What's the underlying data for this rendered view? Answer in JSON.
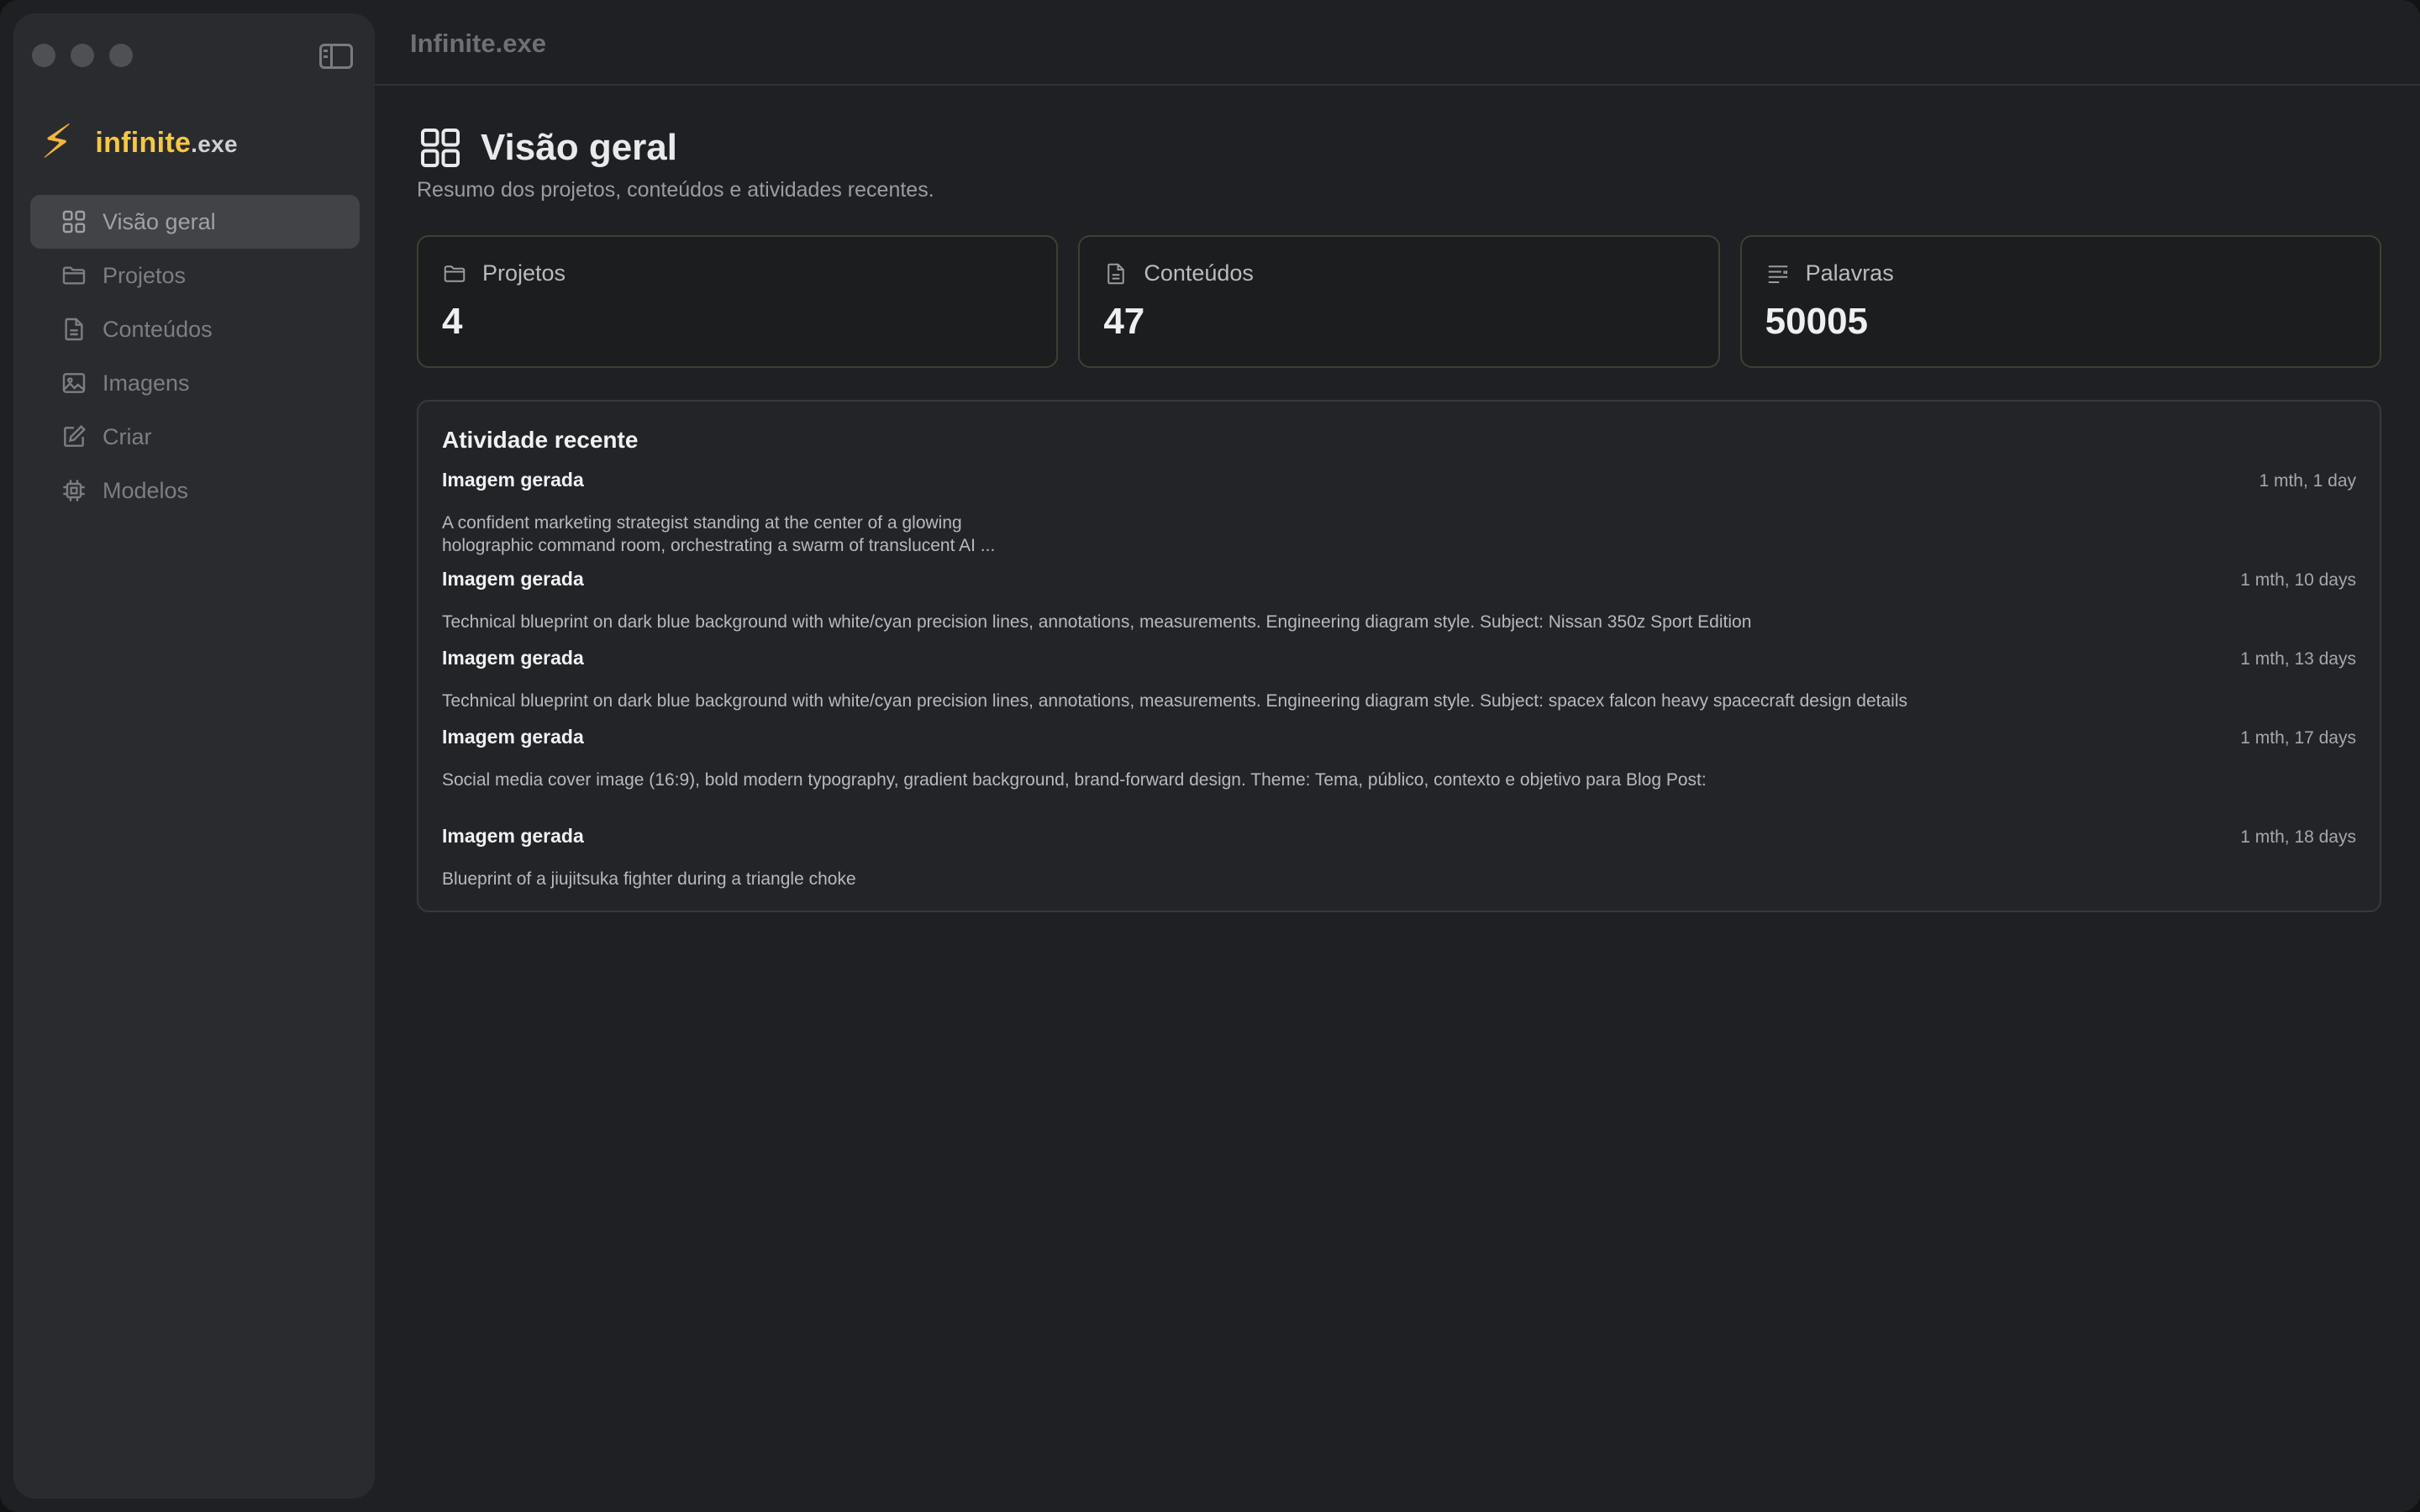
{
  "window": {
    "title": "Infinite.exe"
  },
  "brand": {
    "name": "infinite",
    "ext": ".exe"
  },
  "sidebar": {
    "items": [
      {
        "label": "Visão geral",
        "icon": "grid-icon",
        "active": true
      },
      {
        "label": "Projetos",
        "icon": "folder-icon"
      },
      {
        "label": "Conteúdos",
        "icon": "document-icon"
      },
      {
        "label": "Imagens",
        "icon": "image-icon"
      },
      {
        "label": "Criar",
        "icon": "edit-icon"
      },
      {
        "label": "Modelos",
        "icon": "chip-icon"
      }
    ]
  },
  "page": {
    "title": "Visão geral",
    "subtitle": "Resumo dos projetos, conteúdos e atividades recentes."
  },
  "stats": [
    {
      "label": "Projetos",
      "value": "4",
      "icon": "folder-icon"
    },
    {
      "label": "Conteúdos",
      "value": "47",
      "icon": "document-icon"
    },
    {
      "label": "Palavras",
      "value": "50005",
      "icon": "text-lines-icon"
    }
  ],
  "activity": {
    "title": "Atividade recente",
    "items": [
      {
        "type": "Imagem gerada",
        "time": "1 mth, 1 day",
        "description_lines": [
          "A confident marketing strategist standing at the center of a glowing",
          "holographic command room, orchestrating a swarm of translucent AI ..."
        ]
      },
      {
        "type": "Imagem gerada",
        "time": "1 mth, 10 days",
        "description_lines": [
          "Technical blueprint on dark blue background with white/cyan precision lines, annotations, measurements. Engineering diagram style. Subject: Nissan 350z Sport Edition"
        ]
      },
      {
        "type": "Imagem gerada",
        "time": "1 mth, 13 days",
        "description_lines": [
          "Technical blueprint on dark blue background with white/cyan precision lines, annotations, measurements. Engineering diagram style. Subject: spacex falcon heavy spacecraft design details"
        ]
      },
      {
        "type": "Imagem gerada",
        "time": "1 mth, 17 days",
        "description_lines": [
          "Social media cover image (16:9), bold modern typography, gradient background, brand-forward design. Theme: Tema, público, contexto e objetivo para Blog Post:"
        ]
      },
      {
        "type": "Imagem gerada",
        "time": "1 mth, 18 days",
        "description_lines": [
          "Blueprint of a jiujitsuka fighter during a triangle choke"
        ]
      }
    ]
  },
  "colors": {
    "accent": "#f6c842",
    "background": "#1f2023",
    "sidebar": "#2a2b2e"
  }
}
